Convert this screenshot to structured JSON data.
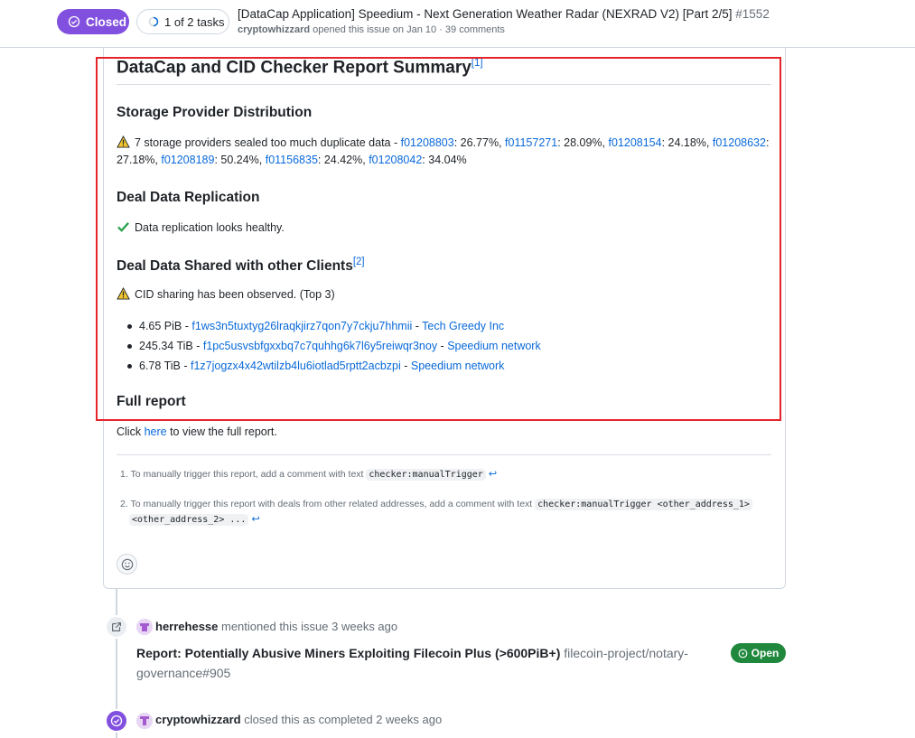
{
  "header": {
    "state_label": "Closed",
    "tasks_label": "1 of 2 tasks",
    "title": "[DataCap Application] Speedium - Next Generation Weather Radar (NEXRAD V2) [Part 2/5]",
    "number": "#1552",
    "author": "cryptowhizzard",
    "opened_text": "opened this issue on Jan 10 · 39 comments"
  },
  "report": {
    "title": "DataCap and CID Checker Report Summary",
    "title_ref": "[1]",
    "sp_heading": "Storage Provider Distribution",
    "sp_warning_prefix": "7 storage providers sealed too much duplicate data - ",
    "providers": [
      {
        "id": "f01208803",
        "pct": ": 26.77%, "
      },
      {
        "id": "f01157271",
        "pct": ": 28.09%, "
      },
      {
        "id": "f01208154",
        "pct": ": 24.18%, "
      },
      {
        "id": "f01208632",
        "pct": ": "
      },
      {
        "id": "",
        "pct": "27.18%, "
      },
      {
        "id": "f01208189",
        "pct": ": 50.24%, "
      },
      {
        "id": "f01156835",
        "pct": ": 24.42%, "
      },
      {
        "id": "f01208042",
        "pct": ": 34.04%"
      }
    ],
    "replication_heading": "Deal Data Replication",
    "replication_text": "Data replication looks healthy.",
    "shared_heading": "Deal Data Shared with other Clients",
    "shared_ref": "[2]",
    "shared_warning": "CID sharing has been observed. (Top 3)",
    "shared_items": [
      {
        "size": "4.65 PiB - ",
        "address": "f1ws3n5tuxtyg26lraqkjirz7qon7y7ckju7hhmii",
        "sep": " - ",
        "client": "Tech Greedy Inc"
      },
      {
        "size": "245.34 TiB - ",
        "address": "f1pc5usvsbfgxxbq7c7quhhg6k7l6y5reiwqr3noy",
        "sep": " - ",
        "client": "Speedium network"
      },
      {
        "size": "6.78 TiB - ",
        "address": "f1z7jogzx4x42wtilzb4lu6iotlad5rptt2acbzpi",
        "sep": " - ",
        "client": "Speedium network"
      }
    ],
    "full_heading": "Full report",
    "full_prefix": "Click ",
    "full_link": "here",
    "full_suffix": " to view the full report."
  },
  "footnotes": {
    "fn1_num": "1.",
    "fn1_text": "To manually trigger this report, add a comment with text ",
    "fn1_code": "checker:manualTrigger",
    "fn2_num": "2.",
    "fn2_text": "To manually trigger this report with deals from other related addresses, add a comment with text ",
    "fn2_code_a": "checker:manualTrigger <other_address_1>",
    "fn2_code_b": "<other_address_2> ...",
    "back_glyph": "↩"
  },
  "timeline": {
    "mention_user": "herrehesse",
    "mention_text": " mentioned this issue 3 weeks ago",
    "ref_title": "Report: Potentially Abusive Miners Exploiting Filecoin Plus (>600PiB+)",
    "ref_repo": " filecoin-project/notary-governance#905",
    "ref_state": "Open",
    "closed_user": "cryptowhizzard",
    "closed_text": " closed this as completed 2 weeks ago"
  },
  "colors": {
    "closed_purple": "#8250df",
    "open_green": "#1f883d",
    "link_blue": "#0969da",
    "highlight_red": "#e5232b",
    "warning_yellow": "#f2c62f",
    "check_green": "#2da44e"
  },
  "icons": [
    "issue-closed-icon",
    "progress-icon",
    "warning-icon",
    "check-icon",
    "smiley-icon",
    "cross-reference-icon",
    "avatar",
    "open-issue-icon",
    "check-circle-icon"
  ]
}
